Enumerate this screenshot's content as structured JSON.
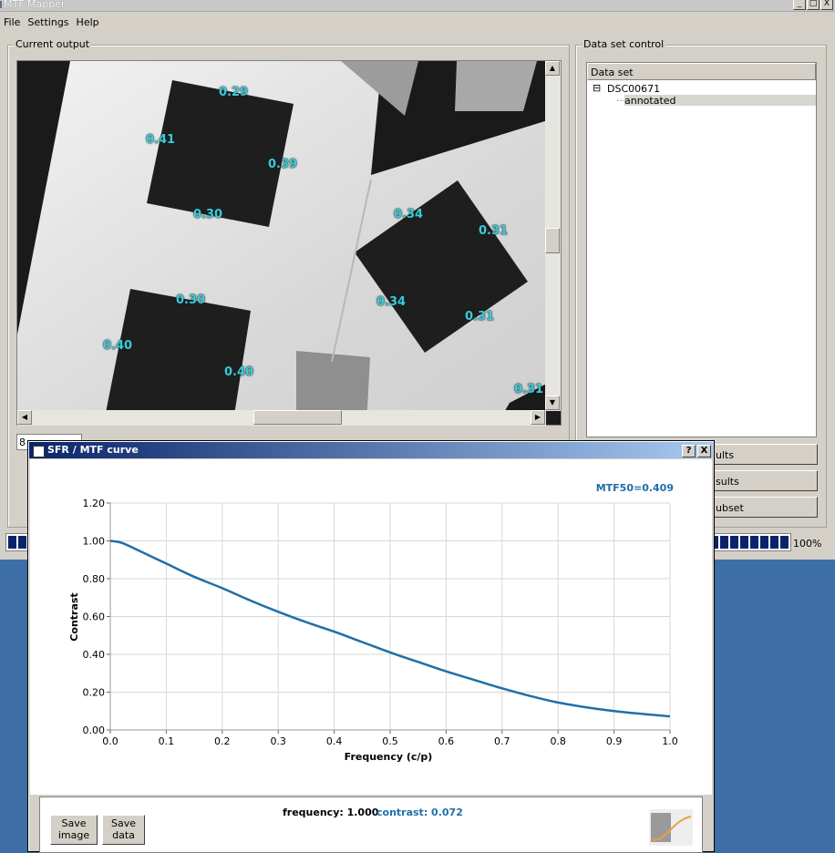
{
  "window": {
    "title": "MTF Mapper",
    "menu": [
      "File",
      "Settings",
      "Help"
    ],
    "buttons": [
      "_",
      "□",
      "X"
    ]
  },
  "current_output": {
    "group_label": "Current output",
    "combo_value": "8",
    "edge_labels": [
      "0.29",
      "0.41",
      "0.39",
      "0.30",
      "0.34",
      "0.31",
      "0.34",
      "0.31",
      "0.30",
      "0.40",
      "0.40",
      "0.31"
    ]
  },
  "data_set_control": {
    "group_label": "Data set control",
    "header": "Data set",
    "tree": {
      "root": "DSC00671",
      "child": "annotated"
    },
    "buttons": [
      "ults",
      "sults",
      "ubset"
    ]
  },
  "progress": {
    "label": "100%",
    "value": 1.0
  },
  "dialog": {
    "title": "SFR / MTF curve",
    "help_button": "?",
    "close_button": "X",
    "save_image": [
      "Save",
      "image"
    ],
    "save_data": [
      "Save",
      "data"
    ],
    "readout_frequency": "frequency: 1.000",
    "readout_contrast": "contrast: 0.072"
  },
  "colors": {
    "curve": "#1f6fa8",
    "label_overlay": "#43c7d6",
    "title_gradient_start": "#0a246a"
  },
  "chart_data": {
    "type": "line",
    "annotation": "MTF50=0.409",
    "xlabel": "Frequency (c/p)",
    "ylabel": "Contrast",
    "xlim": [
      0.0,
      1.0
    ],
    "ylim": [
      0.0,
      1.2
    ],
    "xticks": [
      "0.0",
      "0.1",
      "0.2",
      "0.3",
      "0.4",
      "0.5",
      "0.6",
      "0.7",
      "0.8",
      "0.9",
      "1.0"
    ],
    "yticks": [
      "0.00",
      "0.20",
      "0.40",
      "0.60",
      "0.80",
      "1.00",
      "1.20"
    ],
    "grid": true,
    "series": [
      {
        "x": [
          0.0,
          0.02,
          0.05,
          0.1,
          0.15,
          0.2,
          0.25,
          0.3,
          0.35,
          0.4,
          0.45,
          0.5,
          0.55,
          0.6,
          0.65,
          0.7,
          0.75,
          0.8,
          0.85,
          0.9,
          0.95,
          1.0
        ],
        "y": [
          1.0,
          0.99,
          0.95,
          0.88,
          0.81,
          0.75,
          0.685,
          0.625,
          0.57,
          0.52,
          0.465,
          0.41,
          0.36,
          0.31,
          0.265,
          0.22,
          0.18,
          0.145,
          0.12,
          0.1,
          0.085,
          0.072
        ]
      }
    ]
  }
}
